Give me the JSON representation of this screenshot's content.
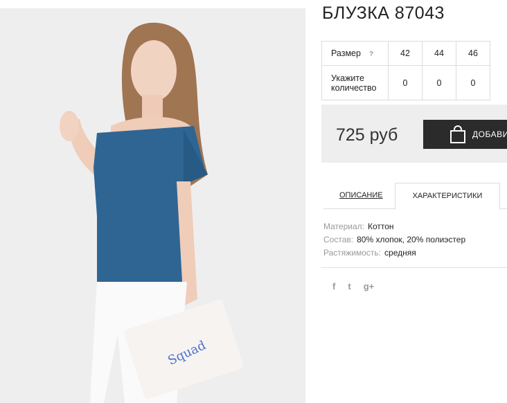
{
  "product": {
    "title": "БЛУЗКА 87043",
    "price": "725 руб"
  },
  "sizes": {
    "header_label": "Размер",
    "help": "?",
    "values": [
      "42",
      "44",
      "46"
    ],
    "qty_label_line1": "Укажите",
    "qty_label_line2": "количество",
    "quantities": [
      "0",
      "0",
      "0"
    ]
  },
  "cart": {
    "button_label": "ДОБАВИТЬ"
  },
  "tabs": {
    "description": "ОПИСАНИЕ",
    "characteristics": "ХАРАКТЕРИСТИКИ"
  },
  "specs": [
    {
      "key": "Материал:",
      "value": "Коттон"
    },
    {
      "key": "Состав:",
      "value": "80% хлопок, 20% полиэстер"
    },
    {
      "key": "Растяжимость:",
      "value": "средняя"
    }
  ],
  "social": {
    "facebook": "f",
    "twitter": "t",
    "googleplus": "g+"
  },
  "colors": {
    "button_bg": "#2b2b2b",
    "buybox_bg": "#eeeeee",
    "blouse": "#2f6593"
  }
}
